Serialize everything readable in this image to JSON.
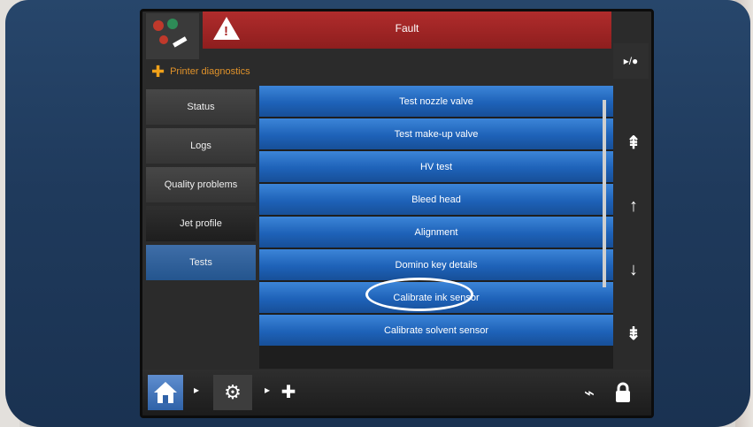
{
  "header": {
    "fault_label": "Fault",
    "top_right_label": "▸/●"
  },
  "section": {
    "title": "Printer diagnostics"
  },
  "sidebar": {
    "items": [
      {
        "label": "Status"
      },
      {
        "label": "Logs"
      },
      {
        "label": "Quality problems"
      },
      {
        "label": "Jet profile"
      },
      {
        "label": "Tests"
      }
    ]
  },
  "list": {
    "items": [
      {
        "label": "Test nozzle valve"
      },
      {
        "label": "Test make-up valve"
      },
      {
        "label": "HV test"
      },
      {
        "label": "Bleed head"
      },
      {
        "label": "Alignment"
      },
      {
        "label": "Domino key details"
      },
      {
        "label": "Calibrate ink sensor"
      },
      {
        "label": "Calibrate solvent sensor"
      }
    ]
  },
  "nav": {
    "top": "⇞",
    "up": "↑",
    "down": "↓",
    "bottom": "⇟"
  },
  "bottom": {
    "separator": "▸",
    "gear": "⚙",
    "cross": "✚",
    "pulse": "⌁"
  },
  "colors": {
    "fault_red": "#a82323",
    "list_blue": "#1e62b8",
    "accent_orange": "#e0922a"
  }
}
